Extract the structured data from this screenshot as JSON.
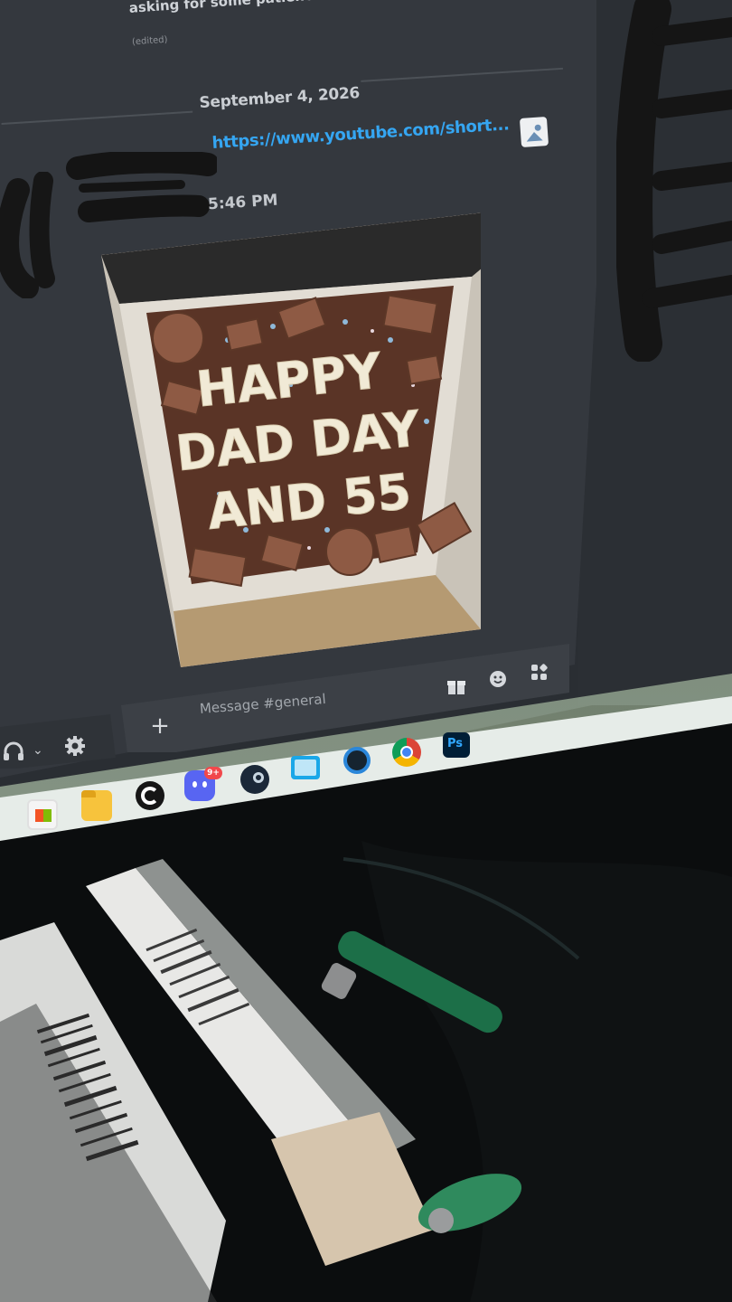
{
  "chat": {
    "previous_message": "asking for some patience and kindness as Asylum memb",
    "previous_edited": "(edited)",
    "date_divider": "September 4, 2026",
    "message": {
      "link": "https://www.youtube.com/short...",
      "timestamp": "5:46 PM",
      "attachment_text": [
        "HAPPY",
        "DAD DAY",
        "AND 55"
      ]
    }
  },
  "composer": {
    "placeholder": "Message #general",
    "icons": [
      "plus-icon",
      "gift-icon",
      "emoji-icon",
      "apps-icon"
    ]
  },
  "user_area": {
    "icons": [
      "headphone-icon",
      "chevron-down-icon",
      "gear-icon"
    ]
  },
  "taskbar": {
    "discord_badge": "9+",
    "photoshop_label": "Ps",
    "icons": [
      "store-icon",
      "folder-icon",
      "g-hub-icon",
      "discord-icon",
      "steam-icon",
      "photos-icon",
      "cortana-icon",
      "chrome-icon",
      "photoshop-icon"
    ]
  },
  "colors": {
    "link": "#35a6f2",
    "chat_bg": "#34383e",
    "badge": "#f1484b"
  }
}
